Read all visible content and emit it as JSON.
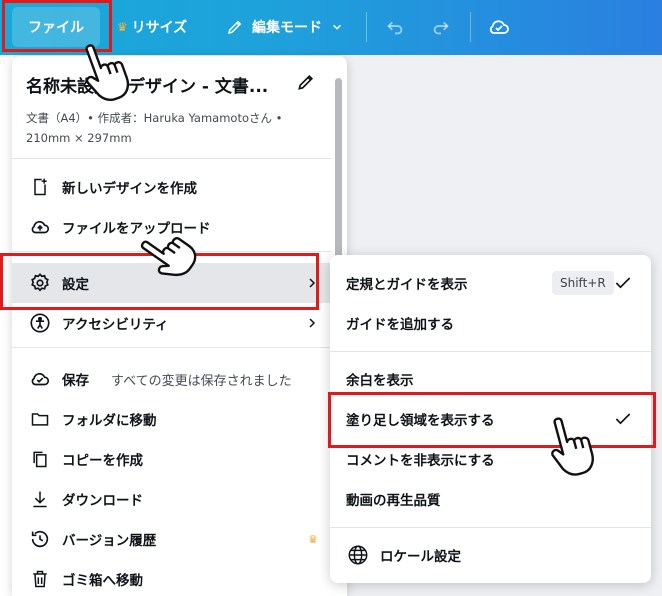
{
  "topbar": {
    "file_label": "ファイル",
    "resize_label": "リサイズ",
    "edit_mode_label": "編集モード",
    "icons": [
      "crown-icon",
      "pencil-icon",
      "chevron-down-icon",
      "undo-icon",
      "redo-icon",
      "cloud-check-icon"
    ]
  },
  "file_menu": {
    "title": "名称未設定のデザイン - 文書...",
    "meta": "文書（A4）• 作成者：Haruka Yamamotoさん • 210mm × 297mm",
    "items": [
      {
        "label": "新しいデザインを作成",
        "icon": "add-page-icon"
      },
      {
        "label": "ファイルをアップロード",
        "icon": "cloud-upload-icon"
      },
      {
        "label": "設定",
        "icon": "gear-icon"
      },
      {
        "label": "アクセシビリティ",
        "icon": "accessibility-icon"
      },
      {
        "label": "保存",
        "sub": "すべての変更は保存されました",
        "icon": "cloud-check-icon"
      },
      {
        "label": "フォルダに移動",
        "icon": "folder-icon"
      },
      {
        "label": "コピーを作成",
        "icon": "copy-icon"
      },
      {
        "label": "ダウンロード",
        "icon": "download-icon"
      },
      {
        "label": "バージョン履歴",
        "icon": "history-icon"
      },
      {
        "label": "ゴミ箱へ移動",
        "icon": "trash-icon"
      }
    ]
  },
  "settings_submenu": {
    "items": [
      {
        "label": "定規とガイドを表示",
        "shortcut": "Shift+R",
        "checked": true
      },
      {
        "label": "ガイドを追加する"
      },
      {
        "label": "余白を表示"
      },
      {
        "label": "塗り足し領域を表示する",
        "checked": true
      },
      {
        "label": "コメントを非表示にする"
      },
      {
        "label": "動画の再生品質"
      },
      {
        "label": "ロケール設定",
        "icon": "globe-icon"
      }
    ]
  },
  "colors": {
    "topbar_start": "#19a9d9",
    "topbar_end": "#2a7fe0",
    "highlight_frame": "#e01b1b",
    "crown": "#f7b52b"
  }
}
